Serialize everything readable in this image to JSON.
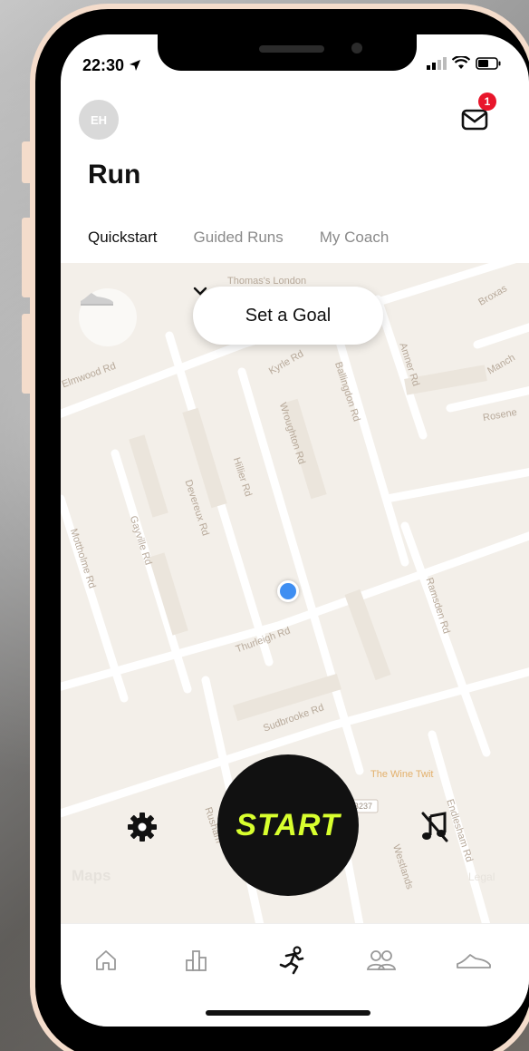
{
  "status_bar": {
    "time": "22:30"
  },
  "header": {
    "avatar_initials": "EH",
    "inbox_badge_count": "1",
    "title": "Run"
  },
  "tabs": [
    {
      "label": "Quickstart",
      "active": true
    },
    {
      "label": "Guided Runs",
      "active": false
    },
    {
      "label": "My Coach",
      "active": false
    }
  ],
  "map": {
    "goal_button_label": "Set a Goal",
    "street_labels": [
      "Thomas's London",
      "Kyrle Rd",
      "Ballingdon Rd",
      "Wroughton Rd",
      "Amner Rd",
      "Hillier Rd",
      "Devereux Rd",
      "Gayville Rd",
      "Mottholme Rd",
      "Thurleigh Rd",
      "Ramsden Rd",
      "Sudbrooke Rd",
      "The Wine Twit",
      "Endlesham Rd",
      "Rusham",
      "Westlands",
      "Manch",
      "Rosene",
      "Broxas",
      "Elmwood Rd"
    ],
    "road_shield": "B237",
    "attribution": "Maps",
    "legal": "Legal"
  },
  "controls": {
    "start_label": "START",
    "settings_icon": "gear-icon",
    "music_icon": "music-off-icon"
  },
  "bottom_nav": [
    {
      "name": "home",
      "icon": "home-icon"
    },
    {
      "name": "activity",
      "icon": "bar-chart-icon"
    },
    {
      "name": "run",
      "icon": "runner-icon",
      "active": true
    },
    {
      "name": "club",
      "icon": "people-icon"
    },
    {
      "name": "shoes",
      "icon": "shoe-icon"
    }
  ],
  "colors": {
    "start_text": "#d8ff2e",
    "user_dot": "#3e8ef2",
    "badge": "#e8162b",
    "phone_frame": "#f4dccb"
  }
}
